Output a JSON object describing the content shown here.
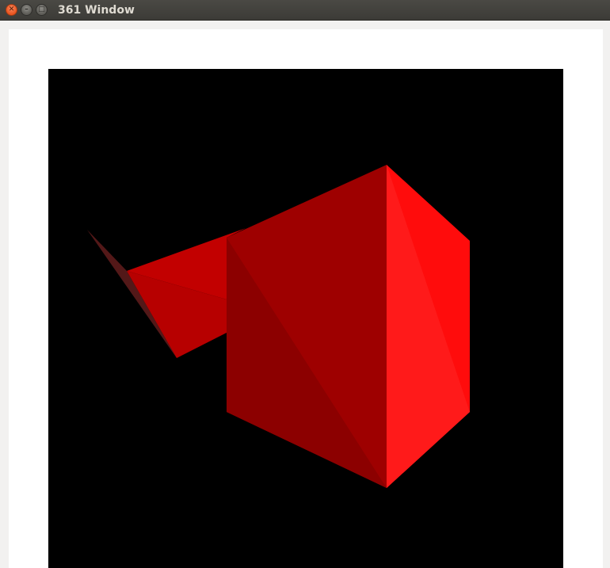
{
  "window": {
    "title": "361 Window",
    "buttons": {
      "close_icon": "close-icon",
      "minimize_icon": "minimize-icon",
      "maximize_icon": "maximize-icon"
    }
  },
  "scene": {
    "background": "#000000",
    "object_color": "#ff0000",
    "shapes": [
      "wedge",
      "cube"
    ]
  }
}
